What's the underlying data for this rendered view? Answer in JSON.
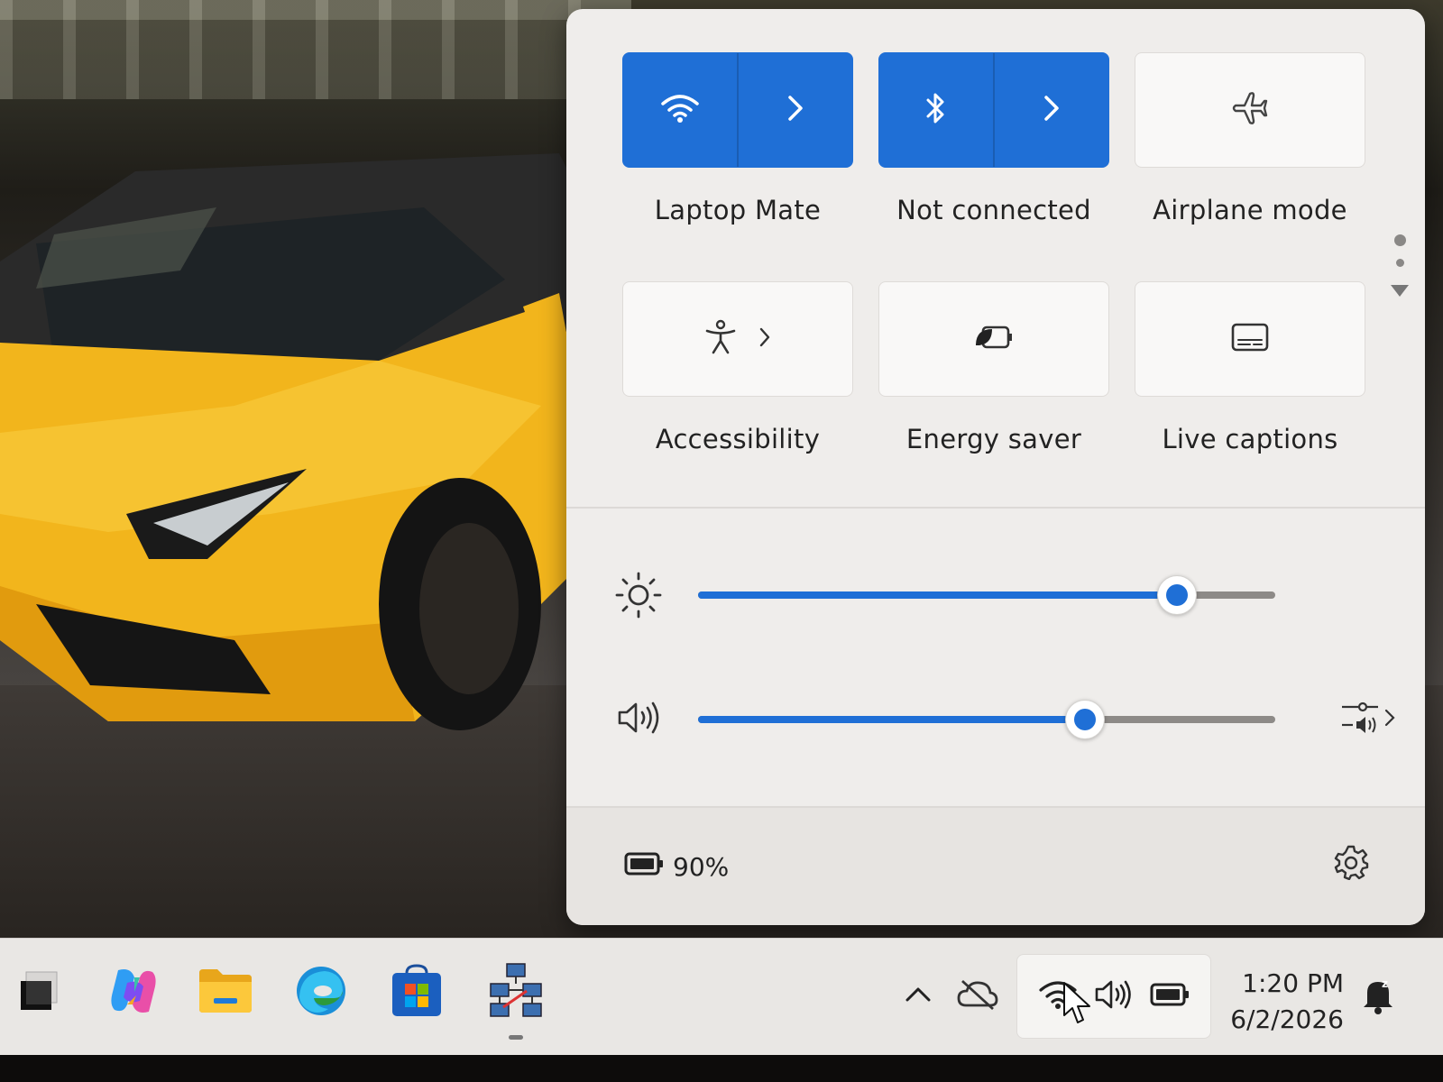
{
  "quick_settings": {
    "tiles": [
      {
        "label": "Laptop Mate",
        "icon": "wifi-icon",
        "active": true,
        "expandable": true
      },
      {
        "label": "Not connected",
        "icon": "bluetooth-icon",
        "active": true,
        "expandable": true
      },
      {
        "label": "Airplane mode",
        "icon": "airplane-icon",
        "active": false,
        "expandable": false
      },
      {
        "label": "Accessibility",
        "icon": "accessibility-icon",
        "active": false,
        "expandable": true
      },
      {
        "label": "Energy saver",
        "icon": "energy-saver-icon",
        "active": false,
        "expandable": false
      },
      {
        "label": "Live captions",
        "icon": "live-captions-icon",
        "active": false,
        "expandable": false
      }
    ],
    "pages": {
      "count": 2,
      "current": 1
    },
    "brightness": {
      "icon": "brightness-icon",
      "level": 0.83
    },
    "volume": {
      "icon": "speaker-icon",
      "level": 0.67
    },
    "battery": {
      "icon": "battery-icon",
      "percent_text": "90%"
    },
    "settings_icon": "gear-icon"
  },
  "taskbar": {
    "apps": [
      {
        "name": "Task View",
        "icon": "task-view-icon"
      },
      {
        "name": "Copilot",
        "icon": "copilot-icon"
      },
      {
        "name": "File Explorer",
        "icon": "folder-icon"
      },
      {
        "name": "Microsoft Edge",
        "icon": "edge-icon"
      },
      {
        "name": "Microsoft Store",
        "icon": "store-icon"
      },
      {
        "name": "Network app",
        "icon": "network-computers-icon",
        "running": true
      }
    ],
    "tray": {
      "overflow_icon": "chevron-up-icon",
      "onedrive_icon": "cloud-offline-icon",
      "wifi_icon": "wifi-icon",
      "volume_icon": "speaker-icon",
      "battery_icon": "battery-icon"
    },
    "clock": {
      "time": "1:20 PM",
      "date": "6/2/2026"
    },
    "notifications_icon": "bell-snooze-icon"
  },
  "colors": {
    "accent": "#1f6fd6",
    "panel": "#efedeb",
    "taskbar": "#e9e7e4"
  }
}
